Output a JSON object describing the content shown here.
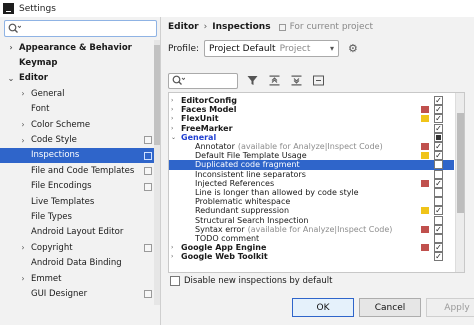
{
  "window": {
    "title": "Settings"
  },
  "search": {
    "placeholder": ""
  },
  "sidebar": {
    "items": [
      {
        "label": "Appearance & Behavior",
        "bold": true,
        "chevron": "›",
        "indent": 0
      },
      {
        "label": "Keymap",
        "bold": true,
        "chevron": "",
        "indent": 0
      },
      {
        "label": "Editor",
        "bold": true,
        "chevron": "⌄",
        "indent": 0
      },
      {
        "label": "General",
        "bold": false,
        "chevron": "›",
        "indent": 1
      },
      {
        "label": "Font",
        "bold": false,
        "chevron": "",
        "indent": 1
      },
      {
        "label": "Color Scheme",
        "bold": false,
        "chevron": "›",
        "indent": 1
      },
      {
        "label": "Code Style",
        "bold": false,
        "chevron": "›",
        "indent": 1,
        "copy": true
      },
      {
        "label": "Inspections",
        "bold": false,
        "chevron": "",
        "indent": 1,
        "copy": true,
        "selected": true
      },
      {
        "label": "File and Code Templates",
        "bold": false,
        "chevron": "",
        "indent": 1,
        "copy": true
      },
      {
        "label": "File Encodings",
        "bold": false,
        "chevron": "",
        "indent": 1,
        "copy": true
      },
      {
        "label": "Live Templates",
        "bold": false,
        "chevron": "",
        "indent": 1
      },
      {
        "label": "File Types",
        "bold": false,
        "chevron": "",
        "indent": 1
      },
      {
        "label": "Android Layout Editor",
        "bold": false,
        "chevron": "",
        "indent": 1
      },
      {
        "label": "Copyright",
        "bold": false,
        "chevron": "›",
        "indent": 1,
        "copy": true
      },
      {
        "label": "Android Data Binding",
        "bold": false,
        "chevron": "",
        "indent": 1
      },
      {
        "label": "Emmet",
        "bold": false,
        "chevron": "›",
        "indent": 1
      },
      {
        "label": "GUI Designer",
        "bold": false,
        "chevron": "",
        "indent": 1,
        "copy": true
      }
    ]
  },
  "breadcrumb": {
    "part1": "Editor",
    "separator": "›",
    "part2": "Inspections",
    "project_note": "For current project"
  },
  "profile": {
    "label": "Profile:",
    "value": "Project Default",
    "scope": "Project"
  },
  "inspections": {
    "rows": [
      {
        "label": "EditorConfig",
        "level": 0,
        "bold": true,
        "chevron": "›",
        "severity": "",
        "check": "checked"
      },
      {
        "label": "Faces Model",
        "level": 0,
        "bold": true,
        "chevron": "›",
        "severity": "#c0504d",
        "check": "checked"
      },
      {
        "label": "FlexUnit",
        "level": 0,
        "bold": true,
        "chevron": "›",
        "severity": "#f0c419",
        "check": "checked"
      },
      {
        "label": "FreeMarker",
        "level": 0,
        "bold": true,
        "chevron": "›",
        "severity": "",
        "check": "checked"
      },
      {
        "label": "General",
        "level": 0,
        "bold": true,
        "blue": true,
        "chevron": "⌄",
        "severity": "",
        "check": "partial"
      },
      {
        "label": "Annotator",
        "note": "(available for Analyze|Inspect Code)",
        "level": 1,
        "severity": "#c0504d",
        "check": "checked"
      },
      {
        "label": "Default File Template Usage",
        "level": 1,
        "severity": "#f0c419",
        "check": "checked"
      },
      {
        "label": "Duplicated code fragment",
        "level": 1,
        "severity": "",
        "check": "unchecked",
        "selected": true
      },
      {
        "label": "Inconsistent line separators",
        "level": 1,
        "severity": "",
        "check": "unchecked"
      },
      {
        "label": "Injected References",
        "level": 1,
        "severity": "#c0504d",
        "check": "checked"
      },
      {
        "label": "Line is longer than allowed by code style",
        "level": 1,
        "severity": "",
        "check": "unchecked"
      },
      {
        "label": "Problematic whitespace",
        "level": 1,
        "severity": "",
        "check": "unchecked"
      },
      {
        "label": "Redundant suppression",
        "level": 1,
        "severity": "#f0c419",
        "check": "checked"
      },
      {
        "label": "Structural Search Inspection",
        "level": 1,
        "severity": "",
        "check": "unchecked"
      },
      {
        "label": "Syntax error",
        "note": "(available for Analyze|Inspect Code)",
        "level": 1,
        "severity": "#c0504d",
        "check": "checked"
      },
      {
        "label": "TODO comment",
        "level": 1,
        "severity": "",
        "check": "unchecked"
      },
      {
        "label": "Google App Engine",
        "level": 0,
        "bold": true,
        "chevron": "›",
        "severity": "#c0504d",
        "check": "checked"
      },
      {
        "label": "Google Web Toolkit",
        "level": 0,
        "bold": true,
        "chevron": "›",
        "severity": "",
        "check": "checked"
      }
    ]
  },
  "disable_new": {
    "label": "Disable new inspections by default"
  },
  "buttons": {
    "ok": "OK",
    "cancel": "Cancel",
    "apply": "Apply"
  }
}
